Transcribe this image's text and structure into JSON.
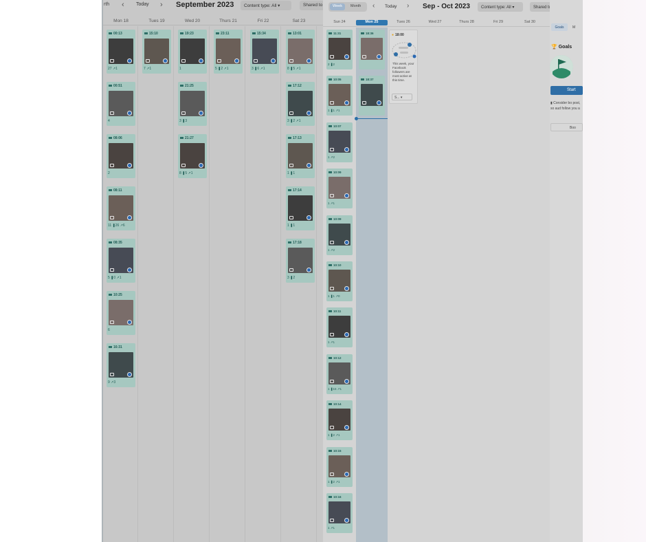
{
  "left_panel": {
    "crumb": "rth",
    "today_label": "Today",
    "title": "September 2023",
    "content_type_label": "Content type: All",
    "shared_to_label": "Shared to",
    "days": [
      "Mon 18",
      "Tues 19",
      "Wed 20",
      "Thurs 21",
      "Fri 22",
      "Sat 23"
    ],
    "posts": {
      "mon": [
        {
          "time": "00:13",
          "stats": "27 ↗1"
        },
        {
          "time": "00:51",
          "stats": "4"
        },
        {
          "time": "08:06",
          "stats": "2"
        },
        {
          "time": "08:11",
          "stats": "11 ❚26 ↗6"
        },
        {
          "time": "08:35",
          "stats": "5 ❚0 ↗1"
        },
        {
          "time": "10:25",
          "stats": "6"
        },
        {
          "time": "16:31",
          "stats": "9 ↗3"
        }
      ],
      "tue": [
        {
          "time": "15:10",
          "stats": "7 ↗1"
        }
      ],
      "wed": [
        {
          "time": "19:23",
          "stats": "1"
        },
        {
          "time": "21:25",
          "stats": "3 ❚3"
        },
        {
          "time": "21:27",
          "stats": "8 ❚5 ↗1"
        }
      ],
      "thu": [
        {
          "time": "23:11",
          "stats": "5 ❚2 ↗1"
        }
      ],
      "fri": [
        {
          "time": "15:34",
          "stats": "3 ❚6 ↗1"
        }
      ],
      "sat": [
        {
          "time": "13:01",
          "stats": "8 ❚5 ↗1"
        },
        {
          "time": "17:12",
          "stats": "3 ❚2 ↗1"
        },
        {
          "time": "17:13",
          "stats": "1 ❚1"
        },
        {
          "time": "17:14",
          "stats": "1 ❚1"
        },
        {
          "time": "17:18",
          "stats": "3 ❚2"
        }
      ]
    }
  },
  "right_panel": {
    "view_week": "Week",
    "view_month": "Month",
    "today_label": "Today",
    "title": "Sep - Oct 2023",
    "content_type_label": "Content type: All",
    "shared_to_label": "Shared to: All",
    "days": [
      "Sun 24",
      "Mon 25",
      "Tues 26",
      "Wed 27",
      "Thurs 28",
      "Fri 29",
      "Sat 30"
    ],
    "posts": {
      "sun": [
        {
          "time": "11:31",
          "stats": "2 ❚2"
        },
        {
          "time": "10:05",
          "stats": "1 ❚1 ↗1"
        },
        {
          "time": "10:07",
          "stats": "1 ↗2"
        },
        {
          "time": "10:09",
          "stats": "1 ↗1"
        },
        {
          "time": "10:09",
          "stats": "1 ↗2"
        },
        {
          "time": "10:10",
          "stats": "1 ❚1 ↗0"
        },
        {
          "time": "10:11",
          "stats": "1 ↗1"
        },
        {
          "time": "10:12",
          "stats": "1 ❚15 ↗1"
        },
        {
          "time": "10:14",
          "stats": "1 ❚2 ↗1"
        },
        {
          "time": "10:15",
          "stats": "1 ❚2 ↗1"
        },
        {
          "time": "10:16",
          "stats": "1 ↗1"
        }
      ],
      "mon": [
        {
          "time": "18:36",
          "stats": ""
        },
        {
          "time": "18:37",
          "stats": ""
        }
      ]
    },
    "tip": {
      "time": "18:00",
      "text": "This week, your Facebook followers are most active at this time.",
      "button": "S..."
    }
  },
  "sidebar": {
    "tab_goals": "Goals",
    "tab_more": "M",
    "goals_header": "Goals",
    "start_button": "Start",
    "consider_text": "Consider bo post, so aud follow you a",
    "boost_button": "Boo"
  },
  "colors": {
    "card_bg": "#a6c8c0",
    "accent": "#2f77b0",
    "facebook": "#2b69b3"
  }
}
